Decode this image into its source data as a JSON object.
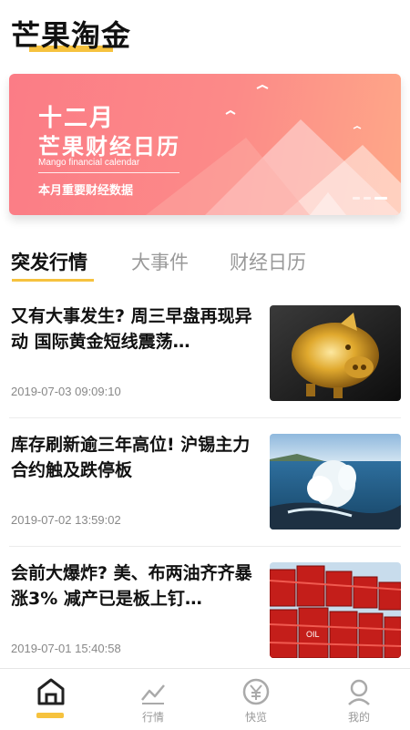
{
  "app": {
    "title": "芒果淘金"
  },
  "banner": {
    "title_line1": "十二月",
    "title_line2": "芒果财经日历",
    "subtitle_en": "Mango financial calendar",
    "description": "本月重要财经数据"
  },
  "tabs": [
    {
      "label": "突发行情",
      "active": true
    },
    {
      "label": "大事件",
      "active": false
    },
    {
      "label": "财经日历",
      "active": false
    }
  ],
  "news": [
    {
      "title": "又有大事发生? 周三早盘再现异动 国际黄金短线震荡…",
      "date": "2019-07-03 09:09:10",
      "thumbnail": "gold-piggy-bank"
    },
    {
      "title": "库存刷新逾三年高位! 沪锡主力合约触及跌停板",
      "date": "2019-07-02 13:59:02",
      "thumbnail": "ocean-wave"
    },
    {
      "title": "会前大爆炸? 美、布两油齐齐暴涨3% 减产已是板上钉…",
      "date": "2019-07-01 15:40:58",
      "thumbnail": "oil-barrels"
    }
  ],
  "bottom_nav": [
    {
      "label": "",
      "icon": "home-icon",
      "active": true
    },
    {
      "label": "行情",
      "icon": "chart-icon",
      "active": false
    },
    {
      "label": "快览",
      "icon": "yuan-icon",
      "active": false
    },
    {
      "label": "我的",
      "icon": "user-icon",
      "active": false
    }
  ],
  "colors": {
    "accent": "#f6c23e",
    "banner_start": "#fb7c86",
    "banner_end": "#fea888",
    "muted_text": "#999999"
  }
}
